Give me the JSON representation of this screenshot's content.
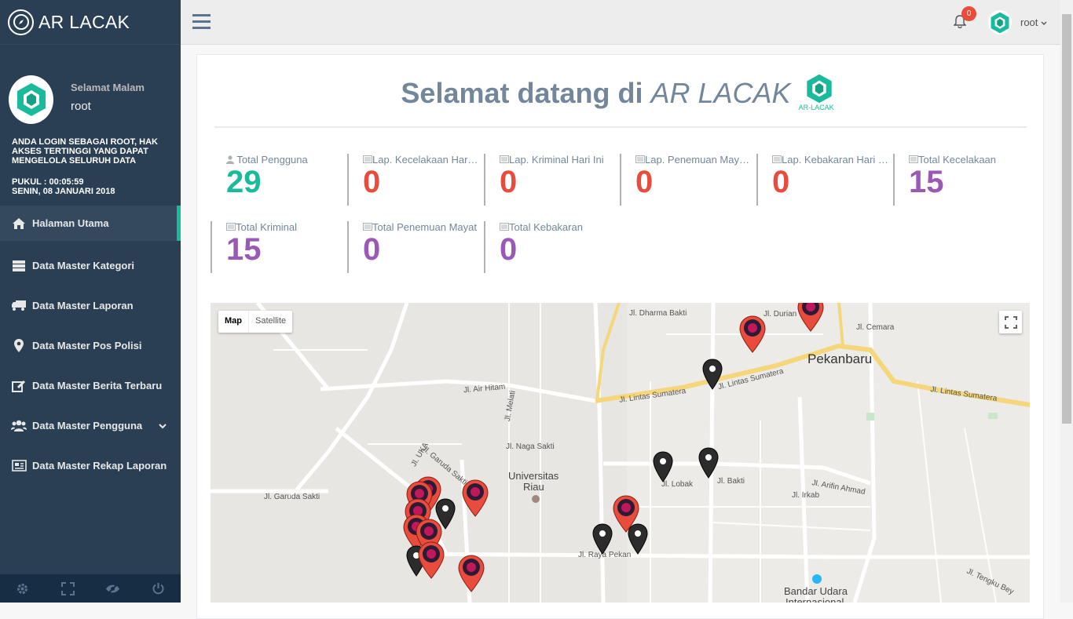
{
  "sidebar": {
    "brand": "AR LACAK",
    "greeting": "Selamat Malam",
    "username": "root",
    "login_info": "ANDA LOGIN SEBAGAI ROOT, HAK AKSES TERTINGGI YANG DAPAT MENGELOLA SELURUH DATA",
    "clock_time": "PUKUL : 00:05:59",
    "clock_date": "SENIN, 08 JANUARI 2018",
    "items": [
      {
        "label": "Halaman Utama",
        "icon": "home-icon"
      },
      {
        "label": "Data Master Kategori",
        "icon": "server-icon"
      },
      {
        "label": "Data Master Laporan",
        "icon": "truck-icon"
      },
      {
        "label": "Data Master Pos Polisi",
        "icon": "map-marker-icon"
      },
      {
        "label": "Data Master Berita Terbaru",
        "icon": "edit-icon"
      },
      {
        "label": "Data Master Pengguna",
        "icon": "users-icon"
      },
      {
        "label": "Data Master Rekap Laporan",
        "icon": "newspaper-icon"
      }
    ]
  },
  "topnav": {
    "notification_count": "0",
    "user": "root"
  },
  "main": {
    "welcome_prefix": "Selamat datang di ",
    "welcome_app": "AR LACAK",
    "logo_caption": "AR-LACAK",
    "tiles": [
      {
        "label": "Total Pengguna",
        "value": "29"
      },
      {
        "label": "Lap. Kecelakaan Hari Ini",
        "value": "0"
      },
      {
        "label": "Lap. Kriminal Hari Ini",
        "value": "0"
      },
      {
        "label": "Lap. Penemuan Mayat Hari Ini",
        "value": "0"
      },
      {
        "label": "Lap. Kebakaran Hari Ini",
        "value": "0"
      },
      {
        "label": "Total Kecelakaan",
        "value": "15"
      },
      {
        "label": "Total Kriminal",
        "value": "15"
      },
      {
        "label": "Total Penemuan Mayat",
        "value": "0"
      },
      {
        "label": "Total Kebakaran",
        "value": "0"
      }
    ]
  },
  "map": {
    "type_map": "Map",
    "type_satellite": "Satellite",
    "labels": {
      "city": "Pekanbaru",
      "univ1": "Universitas",
      "univ2": "Riau",
      "airport1": "Bandar Udara",
      "airport2": "Internasional",
      "r1": "Jl. Dharma Bakti",
      "r2": "Jl. Durian",
      "r3": "Jl. Lintas Sumatera",
      "r4": "Jl. Lintas Sumatera",
      "r5": "Jl. Lintas Sumatera",
      "r6": "Jl. Air Hitam",
      "r7": "Jl. Naga Sakti",
      "r8": "Jl. Garuda Sakti",
      "r9": "Jl. Garuda Sakti",
      "r10": "Jl. Raya Pekan",
      "r11": "Jl. Arifin Ahmad",
      "r12": "Jl. Lobak",
      "r13": "Jl. Bakti",
      "r14": "Jl. Irkab",
      "r15": "Jl. Tengku Bey",
      "r16": "Jl. Melati",
      "r17": "Jl. Cemara",
      "r18": "Jl. UKA"
    }
  },
  "footer": {
    "icons": [
      "gear-icon",
      "fullscreen-icon",
      "eye-slash-icon",
      "power-icon"
    ]
  }
}
